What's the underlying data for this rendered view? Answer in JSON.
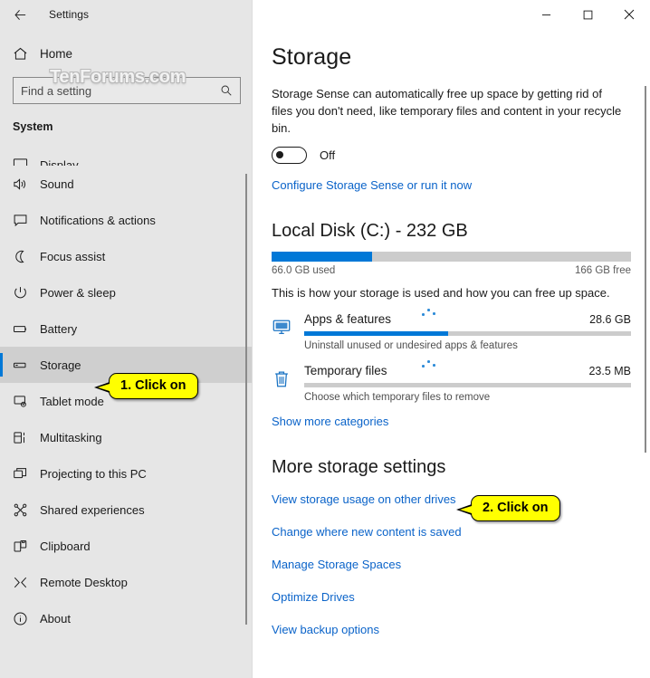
{
  "window": {
    "title": "Settings",
    "back_label": "Back",
    "minimize_label": "Minimize",
    "maximize_label": "Maximize",
    "close_label": "Close",
    "accent_color": "#0078d7"
  },
  "watermark": {
    "text": "TenForums.com"
  },
  "sidebar": {
    "home_label": "Home",
    "search": {
      "value": "",
      "placeholder": "Find a setting"
    },
    "group_header": "System",
    "items": [
      {
        "label": "Display",
        "icon": "display-icon",
        "selected": false,
        "clipped": true
      },
      {
        "label": "Sound",
        "icon": "sound-icon",
        "selected": false,
        "clipped": false
      },
      {
        "label": "Notifications & actions",
        "icon": "notification-icon",
        "selected": false,
        "clipped": false
      },
      {
        "label": "Focus assist",
        "icon": "moon-icon",
        "selected": false,
        "clipped": false
      },
      {
        "label": "Power & sleep",
        "icon": "power-icon",
        "selected": false,
        "clipped": false
      },
      {
        "label": "Battery",
        "icon": "battery-icon",
        "selected": false,
        "clipped": false
      },
      {
        "label": "Storage",
        "icon": "storage-icon",
        "selected": true,
        "clipped": false
      },
      {
        "label": "Tablet mode",
        "icon": "tablet-icon",
        "selected": false,
        "clipped": false
      },
      {
        "label": "Multitasking",
        "icon": "multitasking-icon",
        "selected": false,
        "clipped": false
      },
      {
        "label": "Projecting to this PC",
        "icon": "projecting-icon",
        "selected": false,
        "clipped": false
      },
      {
        "label": "Shared experiences",
        "icon": "shared-icon",
        "selected": false,
        "clipped": false
      },
      {
        "label": "Clipboard",
        "icon": "clipboard-icon",
        "selected": false,
        "clipped": false
      },
      {
        "label": "Remote Desktop",
        "icon": "remote-desktop-icon",
        "selected": false,
        "clipped": false
      },
      {
        "label": "About",
        "icon": "info-icon",
        "selected": false,
        "clipped": false
      }
    ]
  },
  "main": {
    "page_title": "Storage",
    "storage_sense": {
      "description": "Storage Sense can automatically free up space by getting rid of files you don't need, like temporary files and content in your recycle bin.",
      "toggle_state": "Off",
      "configure_link": "Configure Storage Sense or run it now"
    },
    "local_disk": {
      "heading": "Local Disk (C:) - 232 GB",
      "used_label": "66.0 GB used",
      "free_label": "166 GB free",
      "used_percent": 28,
      "description": "This is how your storage is used and how you can free up space."
    },
    "categories": [
      {
        "name": "Apps & features",
        "size": "28.6 GB",
        "subtitle": "Uninstall unused or undesired apps & features",
        "percent": 44,
        "icon": "apps-features-icon"
      },
      {
        "name": "Temporary files",
        "size": "23.5 MB",
        "subtitle": "Choose which temporary files to remove",
        "percent": 0,
        "icon": "trash-icon"
      }
    ],
    "show_more_link": "Show more categories",
    "more_settings": {
      "heading": "More storage settings",
      "links": [
        "View storage usage on other drives",
        "Change where new content is saved",
        "Manage Storage Spaces",
        "Optimize Drives",
        "View backup options"
      ]
    }
  },
  "callouts": [
    {
      "text": "1. Click on"
    },
    {
      "text": "2. Click on"
    }
  ]
}
